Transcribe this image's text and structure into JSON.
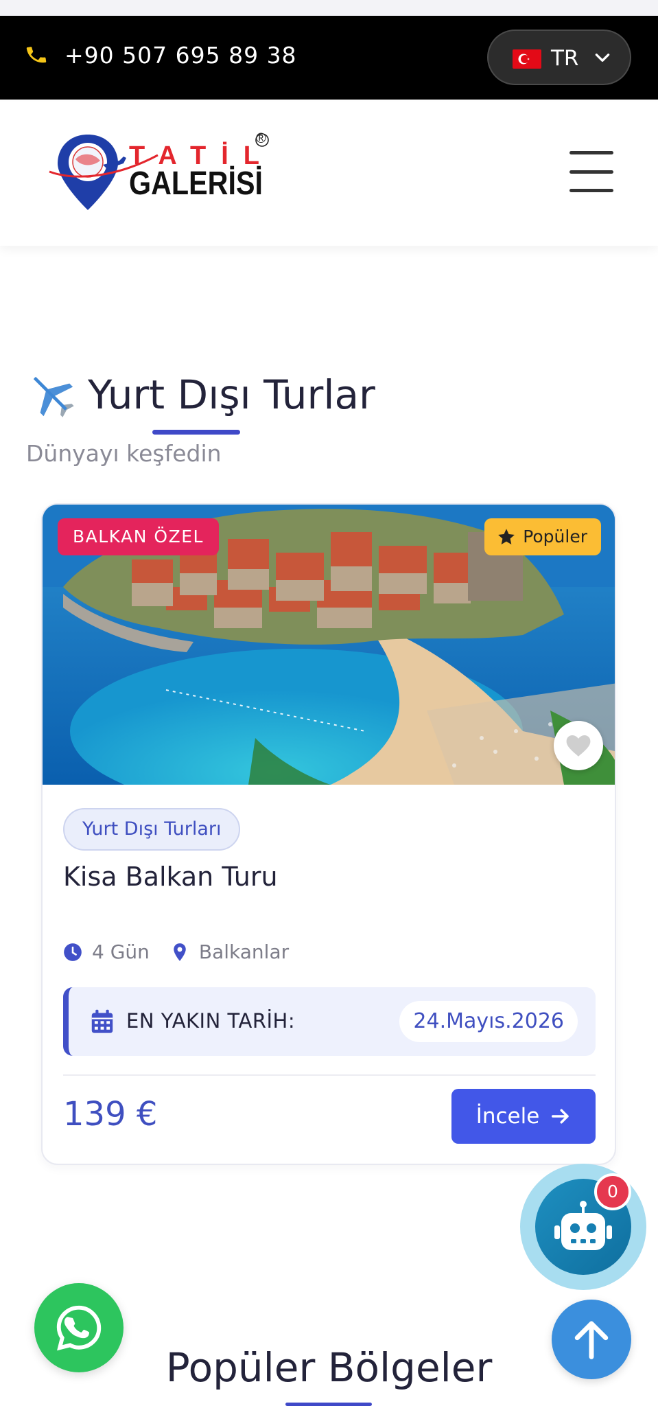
{
  "topbar": {
    "phone": "+90 507 695 89 38",
    "language": {
      "code": "TR",
      "flag": "turkey-flag"
    }
  },
  "header": {
    "logo_line1": "TATİL",
    "logo_line2": "GALERİSİ",
    "logo_mark": "®"
  },
  "section": {
    "title": "Yurt Dışı Turlar",
    "subtitle": "Dünyayı keşfedin"
  },
  "tour_card": {
    "badge_left": "BALKAN ÖZEL",
    "badge_right": "Popüler",
    "category": "Yurt Dışı Turları",
    "title": "Kisa Balkan Turu",
    "duration": "4 Gün",
    "location": "Balkanlar",
    "date_label": "EN YAKIN TARİH:",
    "date_value": "24.Mayıs.2026",
    "price": "139 €",
    "cta": "İncele"
  },
  "chatbot": {
    "unread_count": "0"
  },
  "section2": {
    "title": "Popüler Bölgeler"
  },
  "colors": {
    "accent": "#3f4fc0",
    "button": "#4257e8",
    "badge_pink": "#e4245c",
    "badge_yellow": "#fbbd34",
    "whatsapp": "#2dc55e"
  }
}
